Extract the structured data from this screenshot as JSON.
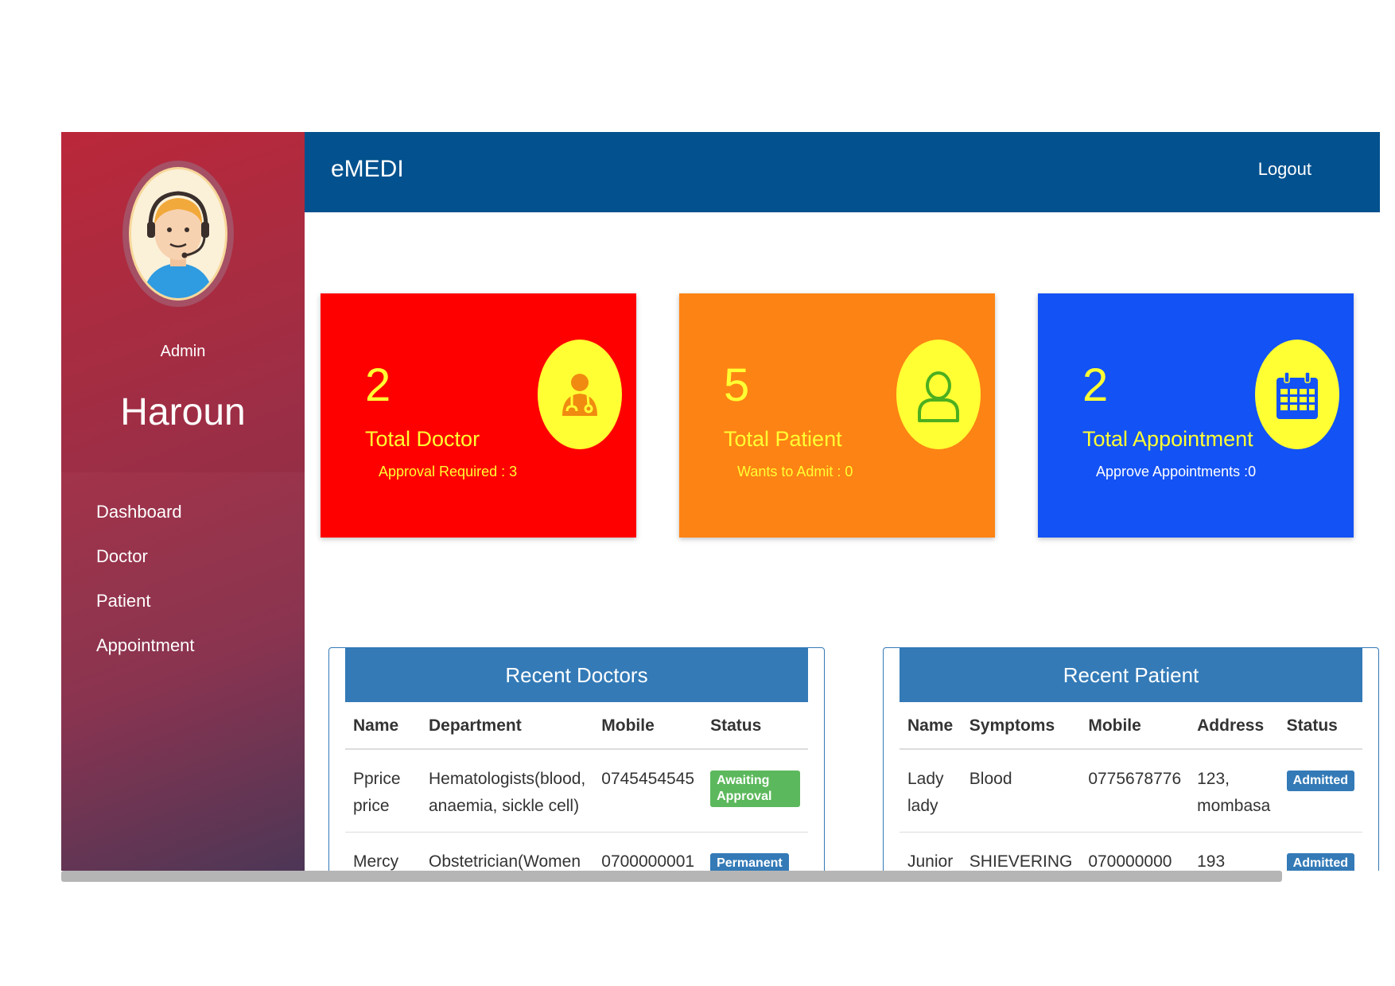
{
  "app": {
    "brand": "eMEDI",
    "logout_label": "Logout"
  },
  "profile": {
    "role": "Admin",
    "name": "Haroun"
  },
  "sidebar": {
    "items": [
      {
        "label": "Dashboard"
      },
      {
        "label": "Doctor"
      },
      {
        "label": "Patient"
      },
      {
        "label": "Appointment"
      }
    ]
  },
  "cards": {
    "doctor": {
      "count": "2",
      "label": "Total Doctor",
      "sub": "Approval Required : 3",
      "icon": "doctor-icon"
    },
    "patient": {
      "count": "5",
      "label": "Total Patient",
      "sub": "Wants to Admit : 0",
      "icon": "user-icon"
    },
    "appointment": {
      "count": "2",
      "label": "Total Appointment",
      "sub": "Approve Appointments :0",
      "icon": "calendar-icon"
    }
  },
  "colors": {
    "sidebar_top": "#c42b3d",
    "topbar": "#03518e",
    "card_doctor": "#ff0000",
    "card_patient": "#fd8314",
    "card_appointment": "#1352f4",
    "icon_circle": "#ffff33",
    "panel_head": "#337ab7"
  },
  "recent_doctors": {
    "title": "Recent Doctors",
    "columns": [
      "Name",
      "Department",
      "Mobile",
      "Status"
    ],
    "rows": [
      {
        "name": "Pprice price",
        "department": "Hematologists(blood, anaemia, sickle cell)",
        "mobile": "0745454545",
        "status": "Awaiting Approval"
      },
      {
        "name": "Mercy",
        "department": "Obstetrician(Women",
        "mobile": "0700000001",
        "status": "Permanent"
      }
    ]
  },
  "recent_patients": {
    "title": "Recent Patient",
    "columns": [
      "Name",
      "Symptoms",
      "Mobile",
      "Address",
      "Status"
    ],
    "rows": [
      {
        "name": "Lady lady",
        "symptoms": "Blood",
        "mobile": "0775678776",
        "address": "123, mombasa",
        "status": "Admitted"
      },
      {
        "name": "Junior",
        "symptoms": "SHIEVERING",
        "mobile": "070000000",
        "address": "193",
        "status": "Admitted"
      }
    ]
  }
}
